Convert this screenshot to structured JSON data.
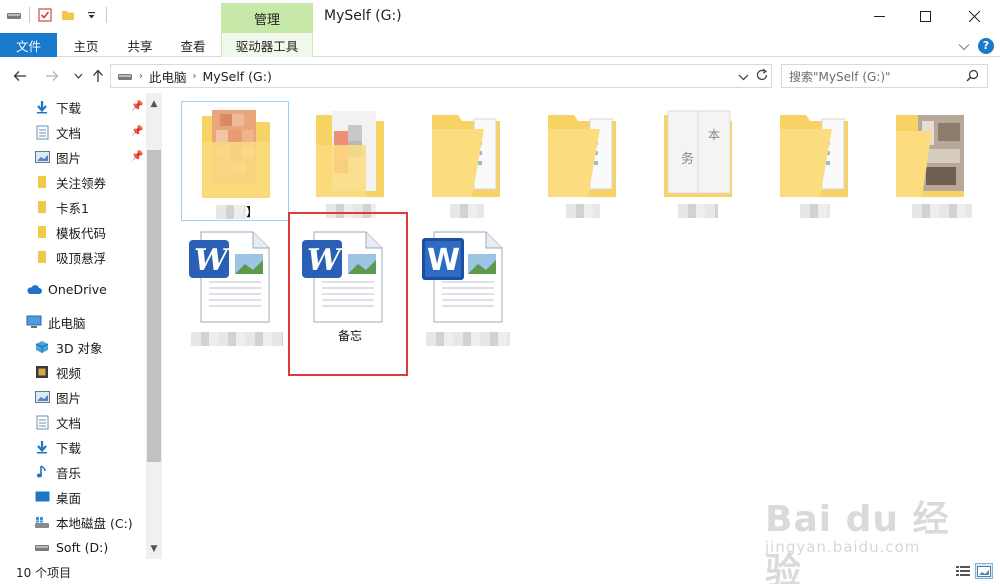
{
  "titlebar": {
    "manage_tab": "管理",
    "window_title": "MySelf (G:)"
  },
  "ribbon": {
    "tabs": [
      "文件",
      "主页",
      "共享",
      "查看",
      "驱动器工具"
    ]
  },
  "address": {
    "path": [
      "此电脑",
      "MySelf (G:)"
    ],
    "search_placeholder": "搜索\"MySelf (G:)\""
  },
  "sidebar": {
    "quick_access": [
      "下载",
      "文档",
      "图片",
      "关注领券",
      "卡系1",
      "模板代码",
      "吸顶悬浮"
    ],
    "onedrive": "OneDrive",
    "this_pc": "此电脑",
    "pc_items": [
      "3D 对象",
      "视频",
      "图片",
      "文档",
      "下载",
      "音乐",
      "桌面",
      "本地磁盘 (C:)",
      "Soft (D:)"
    ]
  },
  "files": {
    "highlighted_doc_name": "备忘",
    "first_folder_caption_fragment": "】"
  },
  "folder_thumb_letters": [
    "务",
    "本"
  ],
  "status": {
    "item_count": "10 个项目"
  },
  "watermark": {
    "line1": "Bai du 经验",
    "line2": "jingyan.baidu.com"
  },
  "colors": {
    "accent": "#1979ca",
    "manage_tab": "#c6e8a8",
    "folder": "#f7d264",
    "highlight_box": "#e23a3a"
  }
}
